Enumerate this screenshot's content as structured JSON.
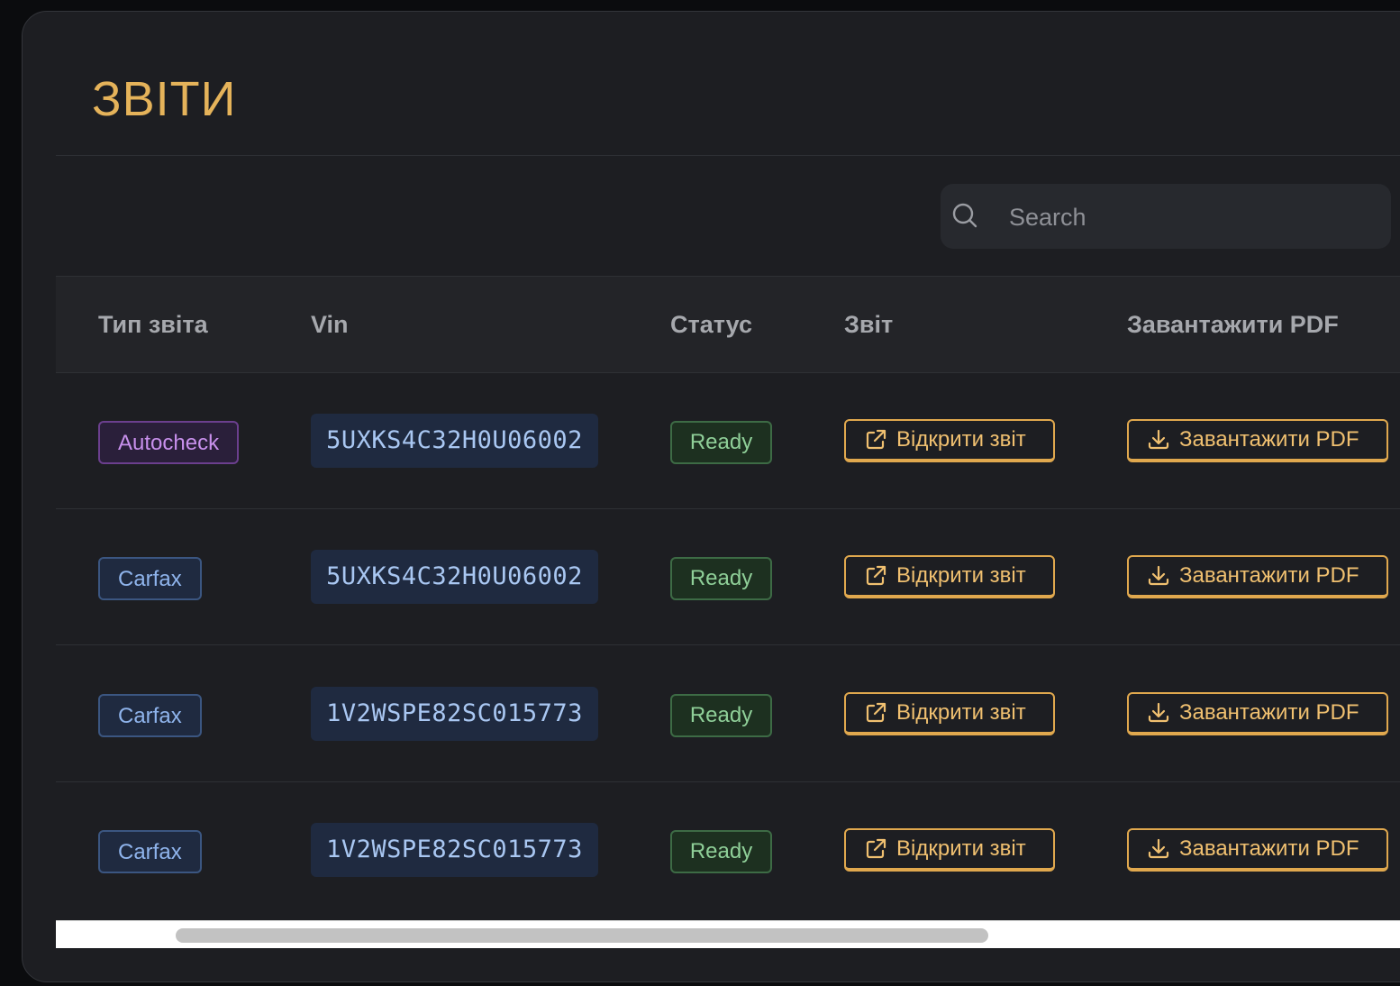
{
  "page": {
    "title": "ЗВІТИ"
  },
  "search": {
    "placeholder": "Search",
    "value": "",
    "icon": "search-icon"
  },
  "table": {
    "columns": [
      "Тип звіта",
      "Vin",
      "Статус",
      "Звіт",
      "Завантажити PDF"
    ],
    "rows": [
      {
        "type": "Autocheck",
        "vin": "5UXKS4C32H0U06002",
        "status": "Ready",
        "open_label": "Відкрити звіт",
        "pdf_label": "Завантажити PDF"
      },
      {
        "type": "Carfax",
        "vin": "5UXKS4C32H0U06002",
        "status": "Ready",
        "open_label": "Відкрити звіт",
        "pdf_label": "Завантажити PDF"
      },
      {
        "type": "Carfax",
        "vin": "1V2WSPE82SC015773",
        "status": "Ready",
        "open_label": "Відкрити звіт",
        "pdf_label": "Завантажити PDF"
      },
      {
        "type": "Carfax",
        "vin": "1V2WSPE82SC015773",
        "status": "Ready",
        "open_label": "Відкрити звіт",
        "pdf_label": "Завантажити PDF"
      }
    ]
  },
  "colors": {
    "accent": "#e5b35a",
    "autocheck": "#c890ec",
    "carfax": "#8fb4ec",
    "ready": "#8fcf98",
    "background": "#1d1e22"
  }
}
